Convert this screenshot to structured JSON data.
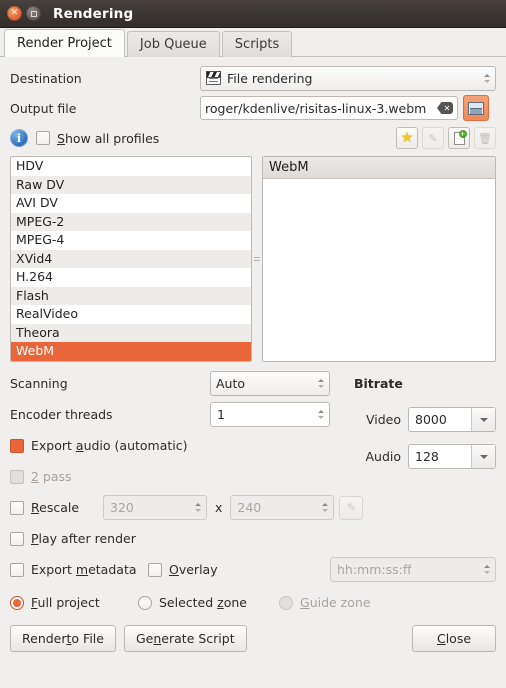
{
  "window": {
    "title": "Rendering",
    "close_icon": "close-icon",
    "maximize_icon": "maximize-icon"
  },
  "tabs": [
    {
      "label": "Render Project",
      "accel": "",
      "active": true
    },
    {
      "label": "Job Queue",
      "accel": "J",
      "active": false
    },
    {
      "label": "Scripts",
      "accel": "",
      "active": false
    }
  ],
  "form": {
    "destination_label": "Destination",
    "destination_value": "File rendering",
    "destination_icon": "clapperboard-icon",
    "output_file_label": "Output file",
    "output_file_value": "roger/kdenlive/risitas-linux-3.webm",
    "output_file_clear_icon": "clear-text-icon",
    "output_file_browse_icon": "folder-open-icon",
    "show_all_profiles_label": "Show all profiles",
    "show_all_profiles_accel": "S",
    "info_icon": "info-icon",
    "profile_buttons": [
      {
        "name": "favorite-profile-button",
        "icon": "star-icon",
        "enabled": true
      },
      {
        "name": "edit-profile-button",
        "icon": "pencil-icon",
        "enabled": false
      },
      {
        "name": "new-profile-button",
        "icon": "new-document-icon",
        "enabled": true
      },
      {
        "name": "delete-profile-button",
        "icon": "trash-icon",
        "enabled": false
      }
    ]
  },
  "profiles": {
    "items": [
      "HDV",
      "Raw DV",
      "AVI DV",
      "MPEG-2",
      "MPEG-4",
      "XVid4",
      "H.264",
      "Flash",
      "RealVideo",
      "Theora",
      "WebM"
    ],
    "selected": "WebM",
    "detail_header": "WebM",
    "detail_body": ""
  },
  "options": {
    "scanning_label": "Scanning",
    "scanning_value": "Auto",
    "encoder_threads_label": "Encoder threads",
    "encoder_threads_value": "1",
    "export_audio_label": "Export audio (automatic)",
    "export_audio_accel": "a",
    "two_pass_label": "2 pass",
    "two_pass_accel": "2",
    "rescale_label": "Rescale",
    "rescale_accel": "R",
    "rescale_width": "320",
    "rescale_height": "240",
    "rescale_x": "x",
    "rescale_icon": "rescale-tool-icon",
    "play_after_render_label": "Play after render",
    "play_after_render_accel": "P",
    "export_metadata_label": "Export metadata",
    "export_metadata_accel": "m",
    "overlay_label": "Overlay",
    "overlay_accel": "O",
    "overlay_placeholder": "hh:mm:ss:ff"
  },
  "bitrate": {
    "title": "Bitrate",
    "video_label": "Video",
    "video_value": "8000",
    "audio_label": "Audio",
    "audio_value": "128"
  },
  "zone": {
    "full_project_label": "Full project",
    "full_project_accel": "F",
    "selected_zone_label": "Selected zone",
    "selected_zone_accel": "z",
    "guide_zone_label": "Guide zone",
    "guide_zone_accel": "G",
    "selected": "Full project"
  },
  "actions": {
    "render_to_file_label": "Render to File",
    "render_to_file_accel": "t",
    "generate_script_label": "Generate Script",
    "generate_script_accel": "n",
    "close_label": "Close",
    "close_accel": "C"
  },
  "colors": {
    "accent": "#e8663a",
    "titlebar": "#3c3633",
    "background": "#f1efee",
    "selection": "#e8663a"
  }
}
